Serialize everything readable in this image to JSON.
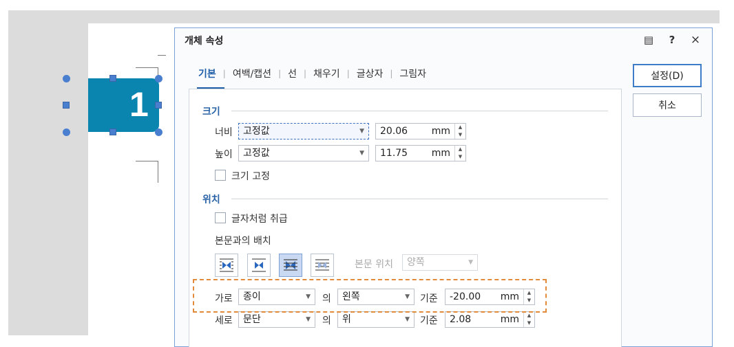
{
  "document": {
    "shape_number": "1"
  },
  "dialog": {
    "title": "개체 속성",
    "title_icons": [
      "memo-icon",
      "help-icon",
      "close-icon"
    ],
    "title_glyphs": {
      "memo": "▤",
      "help": "?",
      "close": "×"
    },
    "tabs": [
      {
        "label": "기본",
        "active": true
      },
      {
        "label": "여백/캡션"
      },
      {
        "label": "선"
      },
      {
        "label": "채우기"
      },
      {
        "label": "글상자"
      },
      {
        "label": "그림자"
      }
    ],
    "buttons": {
      "ok": "설정(D)",
      "cancel": "취소"
    },
    "size": {
      "title": "크기",
      "width_label": "너비",
      "width_mode": "고정값",
      "width_value": "20.06",
      "height_label": "높이",
      "height_mode": "고정값",
      "height_value": "11.75",
      "unit": "mm",
      "lock_label": "크기 고정"
    },
    "position": {
      "title": "위치",
      "treat_as_char_label": "글자처럼 취급",
      "wrap_label": "본문과의 배치",
      "body_pos_label": "본문 위치",
      "body_pos_value": "양쪽",
      "horizontal_label": "가로",
      "horizontal_ref": "종이",
      "of_label": "의",
      "horizontal_align": "왼쪽",
      "basis_label": "기준",
      "horizontal_value": "-20.00",
      "vertical_label": "세로",
      "vertical_ref": "문단",
      "vertical_align": "위",
      "vertical_value": "2.08",
      "unit": "mm"
    }
  },
  "colors": {
    "accent": "#1f5fa8",
    "shape_fill": "#0a85b0",
    "highlight_box": "#e08a3a"
  }
}
